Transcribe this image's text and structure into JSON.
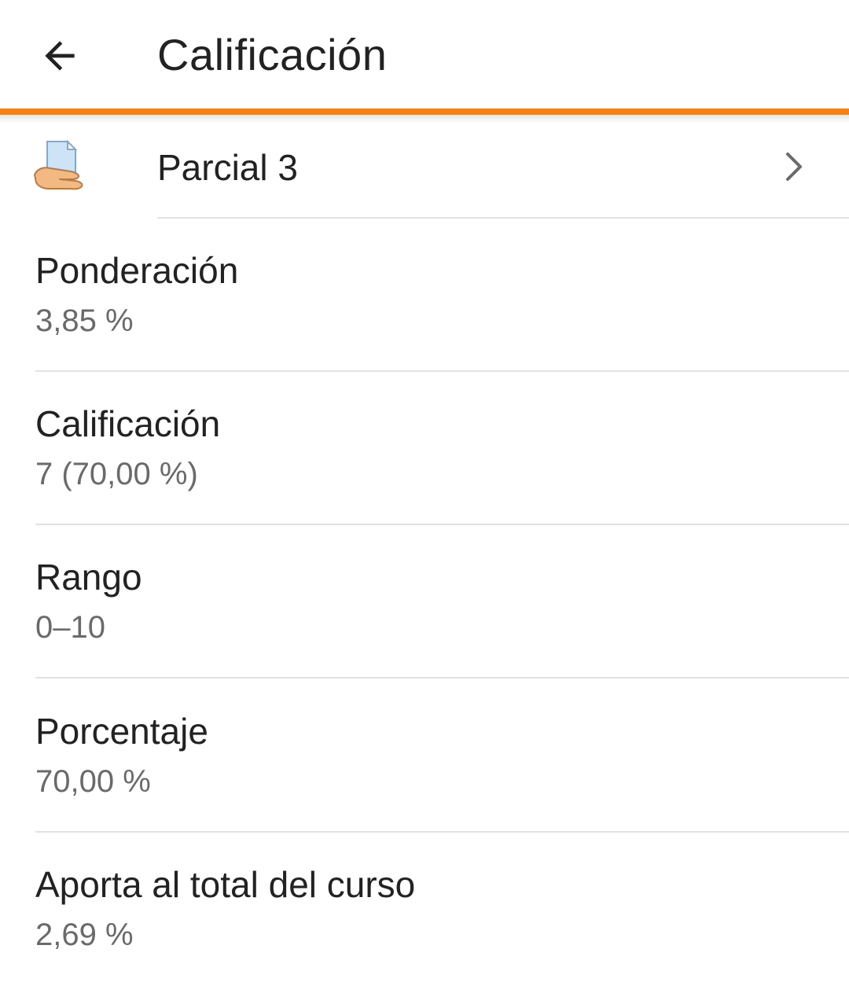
{
  "toolbar": {
    "back_icon": "arrow-left-icon",
    "title": "Calificación",
    "accent_color": "#f98012"
  },
  "module": {
    "icon": "assignment-icon",
    "name": "Parcial 3",
    "chevron_icon": "chevron-right-icon"
  },
  "details": [
    {
      "label": "Ponderación",
      "value": "3,85 %"
    },
    {
      "label": "Calificación",
      "value": "7 (70,00 %)"
    },
    {
      "label": "Rango",
      "value": "0–10"
    },
    {
      "label": "Porcentaje",
      "value": "70,00 %"
    },
    {
      "label": "Aporta al total del curso",
      "value": "2,69 %"
    }
  ]
}
